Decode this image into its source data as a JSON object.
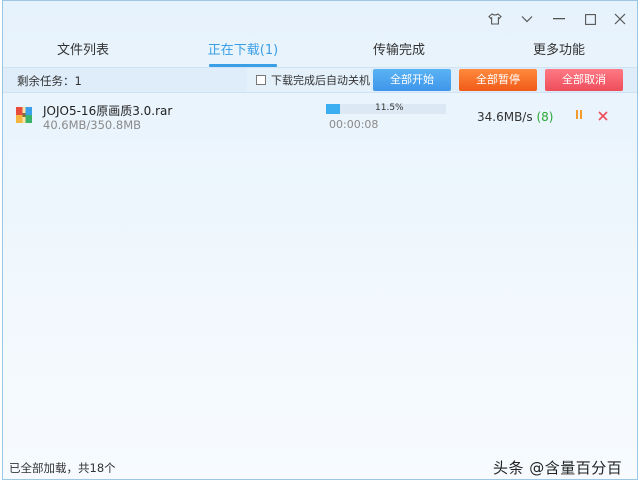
{
  "tabs": [
    {
      "label": "文件列表"
    },
    {
      "label": "正在下载(1)"
    },
    {
      "label": "传输完成"
    },
    {
      "label": "更多功能"
    }
  ],
  "toolbar": {
    "remaining": "剩余任务：1",
    "shutdown_label": "下载完成后自动关机",
    "start_all": "全部开始",
    "pause_all": "全部暂停",
    "cancel_all": "全部取消"
  },
  "download": {
    "file_name": "JOJO5-16原画质3.0.rar",
    "size": "40.6MB/350.8MB",
    "progress": "11.5%",
    "progress_fraction": 0.115,
    "elapsed": "00:00:08",
    "speed": "34.6MB/s",
    "connections": "(8)"
  },
  "status": {
    "text": "已全部加载，共18个"
  },
  "watermark": "头条 @含量百分百",
  "colors": {
    "accent": "#3a9fe6",
    "start": "#4aa6f0",
    "pause": "#f3691f",
    "cancel": "#f05a66",
    "connections": "#2aa837"
  }
}
